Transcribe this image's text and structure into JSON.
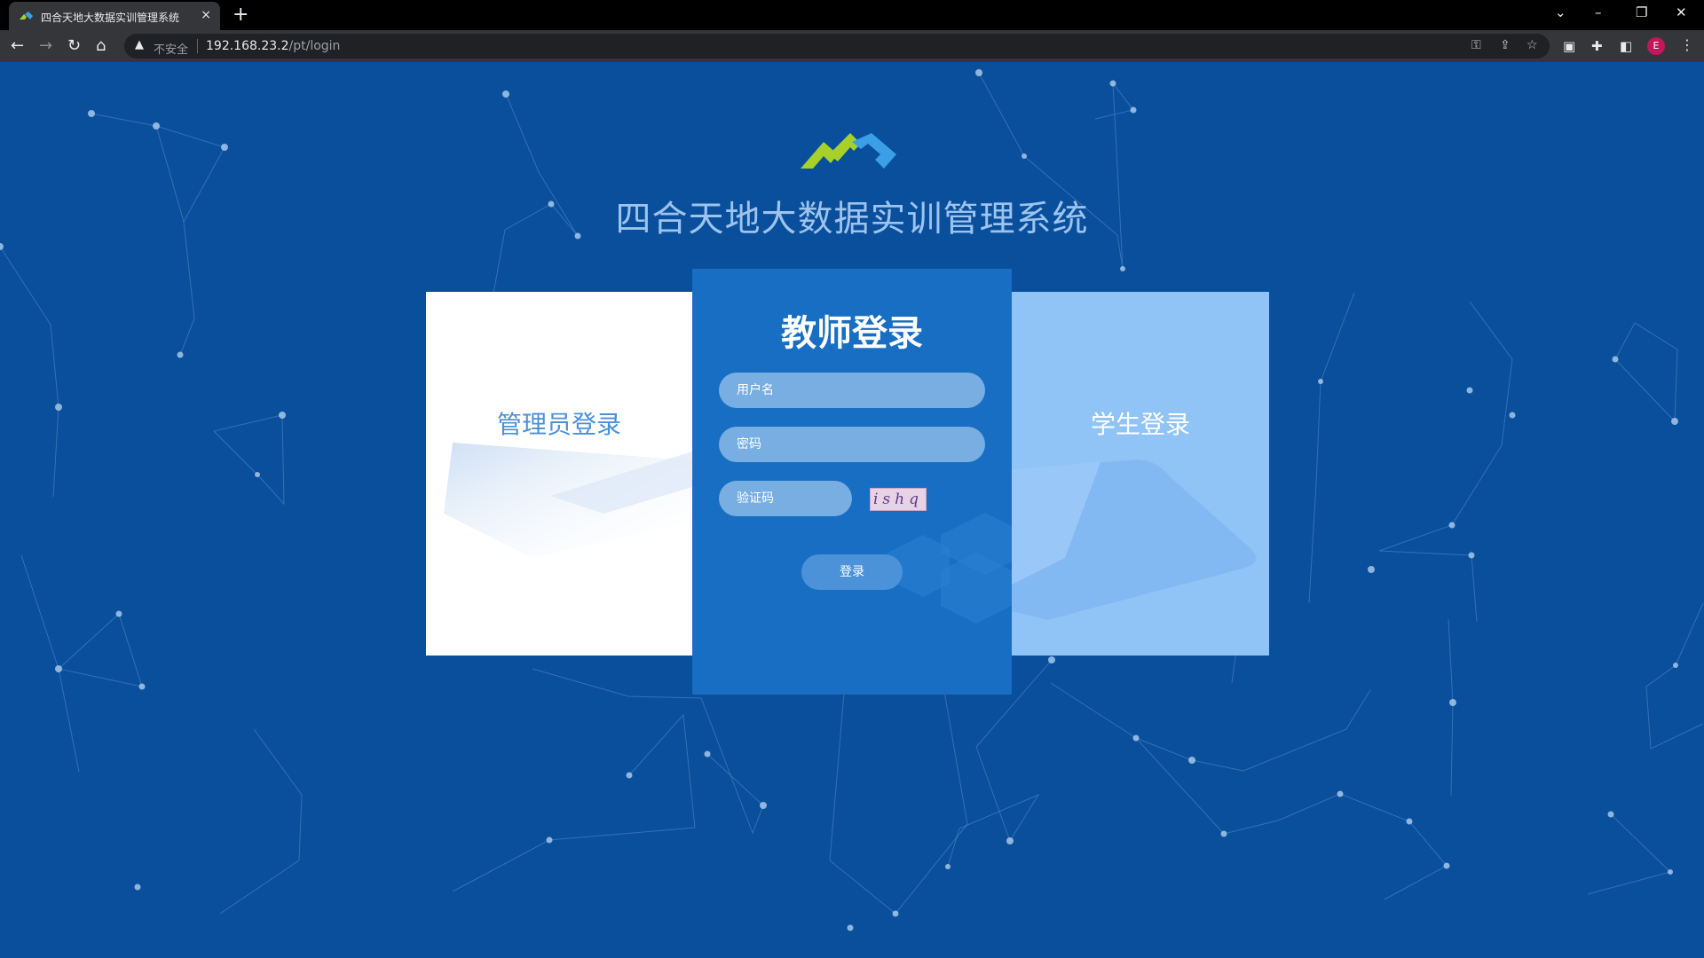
{
  "browser": {
    "tab_title": "四合天地大数据实训管理系统",
    "tab_close": "×",
    "new_tab": "+",
    "nav": {
      "back": "←",
      "forward": "→",
      "reload": "↻",
      "home": "⌂"
    },
    "address": {
      "warning_icon": "▲",
      "insecure_label": "不安全",
      "url_host": "192.168.23.2",
      "url_path": "/pt/login"
    },
    "profile_initial": "E",
    "menu": "⋮",
    "window": {
      "tab_search": "⌄",
      "minimize": "–",
      "restore": "❐",
      "close": "✕"
    }
  },
  "page": {
    "system_title": "四合天地大数据实训管理系统",
    "admin_card": {
      "label": "管理员登录"
    },
    "student_card": {
      "label": "学生登录"
    },
    "teacher_card": {
      "title": "教师登录",
      "username_placeholder": "用户名",
      "password_placeholder": "密码",
      "captcha_placeholder": "验证码",
      "captcha_text": "ishq",
      "login_button": "登录"
    }
  },
  "colors": {
    "background": "#0a4f9c",
    "teacher_card": "#176ec2",
    "student_card": "#90c4f6",
    "admin_card": "#ffffff",
    "logo_green": "#a7d12a",
    "logo_blue": "#3a9ee8"
  }
}
